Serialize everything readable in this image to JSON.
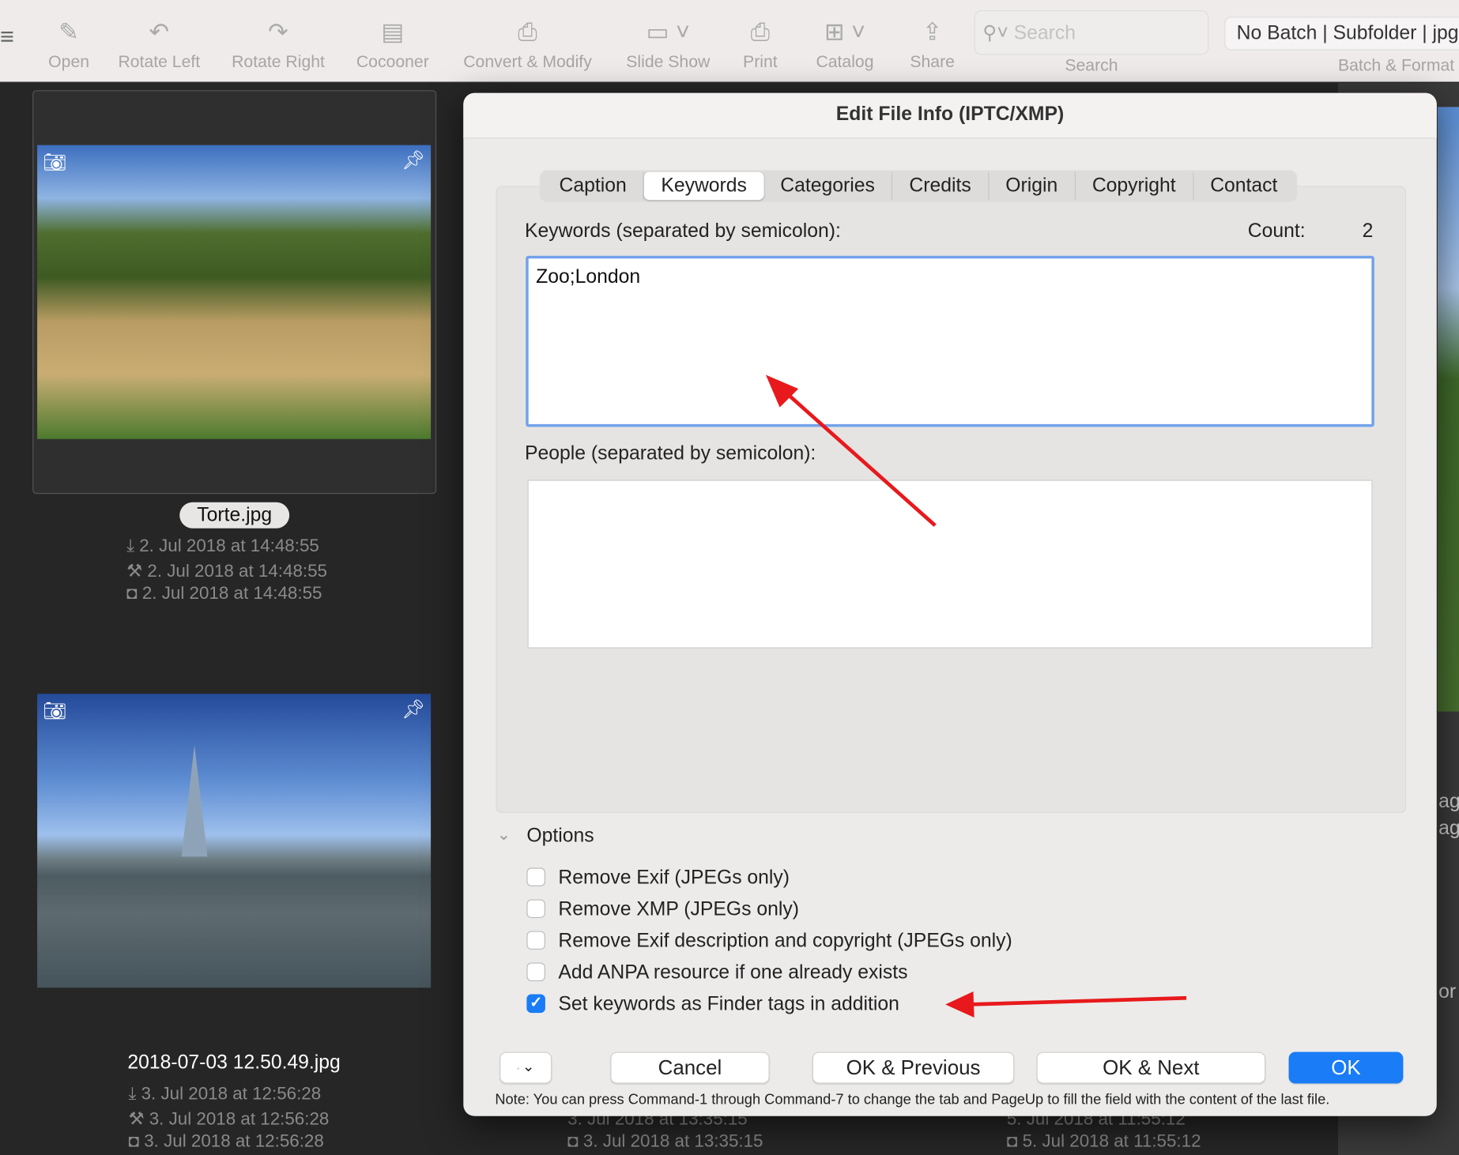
{
  "toolbar": {
    "items": [
      {
        "label": "Open",
        "icon": "open-icon"
      },
      {
        "label": "Rotate Left",
        "icon": "rotate-left-icon"
      },
      {
        "label": "Rotate Right",
        "icon": "rotate-right-icon"
      },
      {
        "label": "Cocooner",
        "icon": "cocooner-icon"
      },
      {
        "label": "Convert & Modify",
        "icon": "convert-icon"
      },
      {
        "label": "Slide Show",
        "icon": "slideshow-icon"
      },
      {
        "label": "Print",
        "icon": "print-icon"
      },
      {
        "label": "Catalog",
        "icon": "catalog-icon"
      },
      {
        "label": "Share",
        "icon": "share-icon"
      }
    ],
    "search_placeholder": "Search",
    "search_label": "Search",
    "batch_value": "No Batch | Subfolder | jpg",
    "batch_label": "Batch & Format"
  },
  "browser": {
    "files": [
      {
        "name": "Torte.jpg",
        "dates": [
          "2. Jul 2018 at 14:48:55",
          "2. Jul 2018 at 14:48:55",
          "2. Jul 2018 at 14:48:55"
        ]
      },
      {
        "name": "2018-07-03 12.50.49.jpg",
        "dates": [
          "3. Jul 2018 at 12:56:28",
          "3. Jul 2018 at 12:56:28",
          "3. Jul 2018 at 12:56:28"
        ]
      }
    ],
    "hidden_dates": [
      "3. Jul 2018 at 13:35:15",
      "3. Jul 2018 at 13:35:15",
      "5. Jul 2018 at 11:55:12",
      "5. Jul 2018 at 11:55:12"
    ],
    "right_partial": [
      "ag",
      "ag",
      "or"
    ]
  },
  "dialog": {
    "title": "Edit File Info (IPTC/XMP)",
    "tabs": [
      "Caption",
      "Keywords",
      "Categories",
      "Credits",
      "Origin",
      "Copyright",
      "Contact"
    ],
    "selected_tab": "Keywords",
    "keywords_label": "Keywords (separated by semicolon):",
    "count_label": "Count:",
    "count_value": "2",
    "keywords_value": "Zoo;London",
    "people_label": "People (separated by semicolon):",
    "people_value": "",
    "options_label": "Options",
    "options": [
      {
        "label": "Remove Exif (JPEGs only)",
        "checked": false
      },
      {
        "label": "Remove XMP (JPEGs only)",
        "checked": false
      },
      {
        "label": "Remove Exif description and copyright (JPEGs only)",
        "checked": false
      },
      {
        "label": "Add ANPA resource if one already exists",
        "checked": false
      },
      {
        "label": "Set keywords as Finder tags in addition",
        "checked": true
      }
    ],
    "buttons": {
      "cancel": "Cancel",
      "previous": "OK & Previous",
      "next": "OK & Next",
      "ok": "OK"
    },
    "note": "Note: You can press Command-1 through Command-7 to change the tab and PageUp to fill the field with the content of the last file."
  },
  "colors": {
    "accent": "#1a7cf6",
    "annotation_arrow": "#e8191c",
    "focus_ring": "#72a2ea"
  }
}
